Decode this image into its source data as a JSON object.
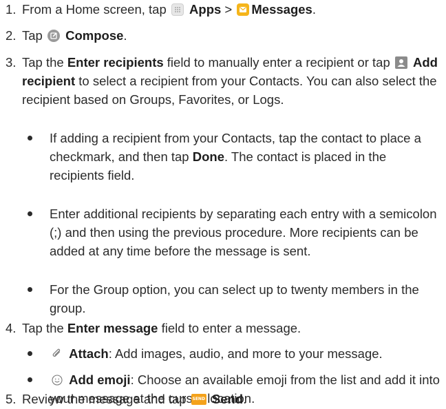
{
  "steps": [
    {
      "num": "1.",
      "t1": "From a Home screen, tap",
      "b1": "Apps",
      "t2": ">",
      "b2": "Messages",
      "t3": "."
    },
    {
      "num": "2.",
      "t1": "Tap",
      "b1": "Compose",
      "t2": "."
    },
    {
      "num": "3.",
      "t1": "Tap the",
      "b1": "Enter recipients",
      "t2": "field to manually enter a recipient or tap",
      "b2": "Add recipient",
      "t3": "to select a recipient from your Contacts. You can also select the recipient based on Groups, Favorites, or Logs.",
      "bullets": [
        {
          "t1": "If adding a recipient from your Contacts, tap the contact to place a checkmark, and then tap",
          "b1": "Done",
          "t2": ". The contact is placed in the recipients field."
        },
        {
          "text": "Enter additional recipients by separating each entry with a semicolon (;) and then using the previous procedure. More recipients can be added at any time before the message is sent."
        },
        {
          "text": "For the Group option, you can select up to twenty members in the group."
        }
      ]
    },
    {
      "num": "4.",
      "t1": "Tap the",
      "b1": "Enter message",
      "t2": "field to enter a message.",
      "bullets": [
        {
          "b1": "Attach",
          "t1": ": Add images, audio, and more to your message."
        },
        {
          "b1": "Add emoji",
          "t1": ": Choose an available emoji from the list and add it into your message at the cursor location."
        }
      ]
    },
    {
      "num": "5.",
      "t1": "Review the message and tap",
      "b1": "Send",
      "t2": "."
    }
  ],
  "icons": {
    "apps": "apps-icon",
    "messages": "messages-icon",
    "compose": "compose-icon",
    "add_recipient": "add-recipient-icon",
    "attach": "attach-icon",
    "emoji": "emoji-icon",
    "send": "send-icon",
    "send_label": "SEND"
  },
  "colors": {
    "text": "#2b2b2b",
    "messages_icon": "#f5b51b",
    "send_icon": "#f4a21b",
    "icon_gray": "#9a9a9a"
  }
}
